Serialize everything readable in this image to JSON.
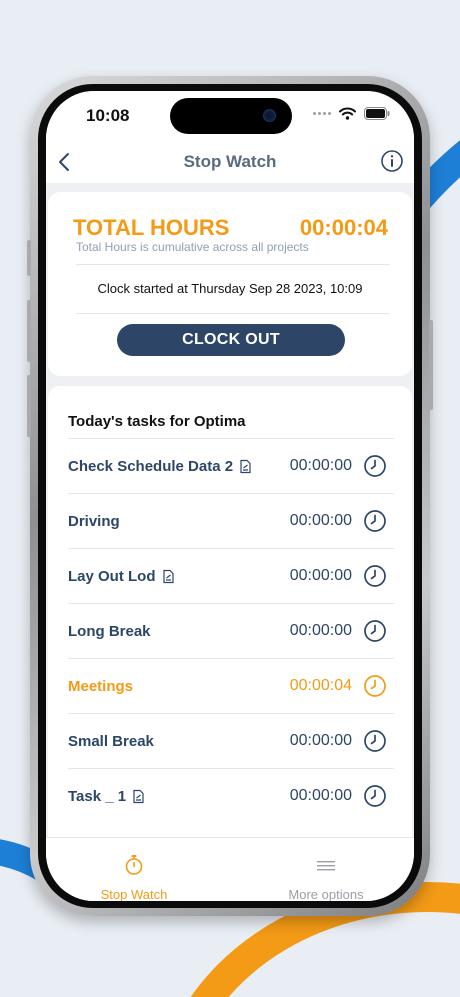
{
  "status_bar": {
    "time": "10:08"
  },
  "nav": {
    "title": "Stop Watch",
    "back_icon": "chevron-left-icon",
    "info_icon": "info-circle-icon"
  },
  "summary": {
    "total_label": "TOTAL HOURS",
    "total_value": "00:00:04",
    "total_subtitle": "Total Hours is cumulative across all projects",
    "clock_started": "Clock started at Thursday Sep 28 2023, 10:09",
    "clock_out_label": "CLOCK OUT"
  },
  "tasks": {
    "heading": "Today's tasks for Optima",
    "items": [
      {
        "name": "Check Schedule Data 2",
        "time": "00:00:00",
        "has_doc_icon": true,
        "active": false
      },
      {
        "name": "Driving",
        "time": "00:00:00",
        "has_doc_icon": false,
        "active": false
      },
      {
        "name": "Lay Out Lod",
        "time": "00:00:00",
        "has_doc_icon": true,
        "active": false
      },
      {
        "name": "Long Break",
        "time": "00:00:00",
        "has_doc_icon": false,
        "active": false
      },
      {
        "name": "Meetings",
        "time": "00:00:04",
        "has_doc_icon": false,
        "active": true
      },
      {
        "name": "Small Break",
        "time": "00:00:00",
        "has_doc_icon": false,
        "active": false
      },
      {
        "name": "Task _ 1",
        "time": "00:00:00",
        "has_doc_icon": true,
        "active": false
      }
    ]
  },
  "tabbar": {
    "stop_watch": {
      "label": "Stop Watch",
      "icon": "stopwatch-icon",
      "active": true
    },
    "more": {
      "label": "More options",
      "icon": "menu-lines-icon",
      "active": false
    }
  },
  "colors": {
    "accent": "#f39a16",
    "navy": "#2d4668",
    "background": "#e9eef4"
  }
}
